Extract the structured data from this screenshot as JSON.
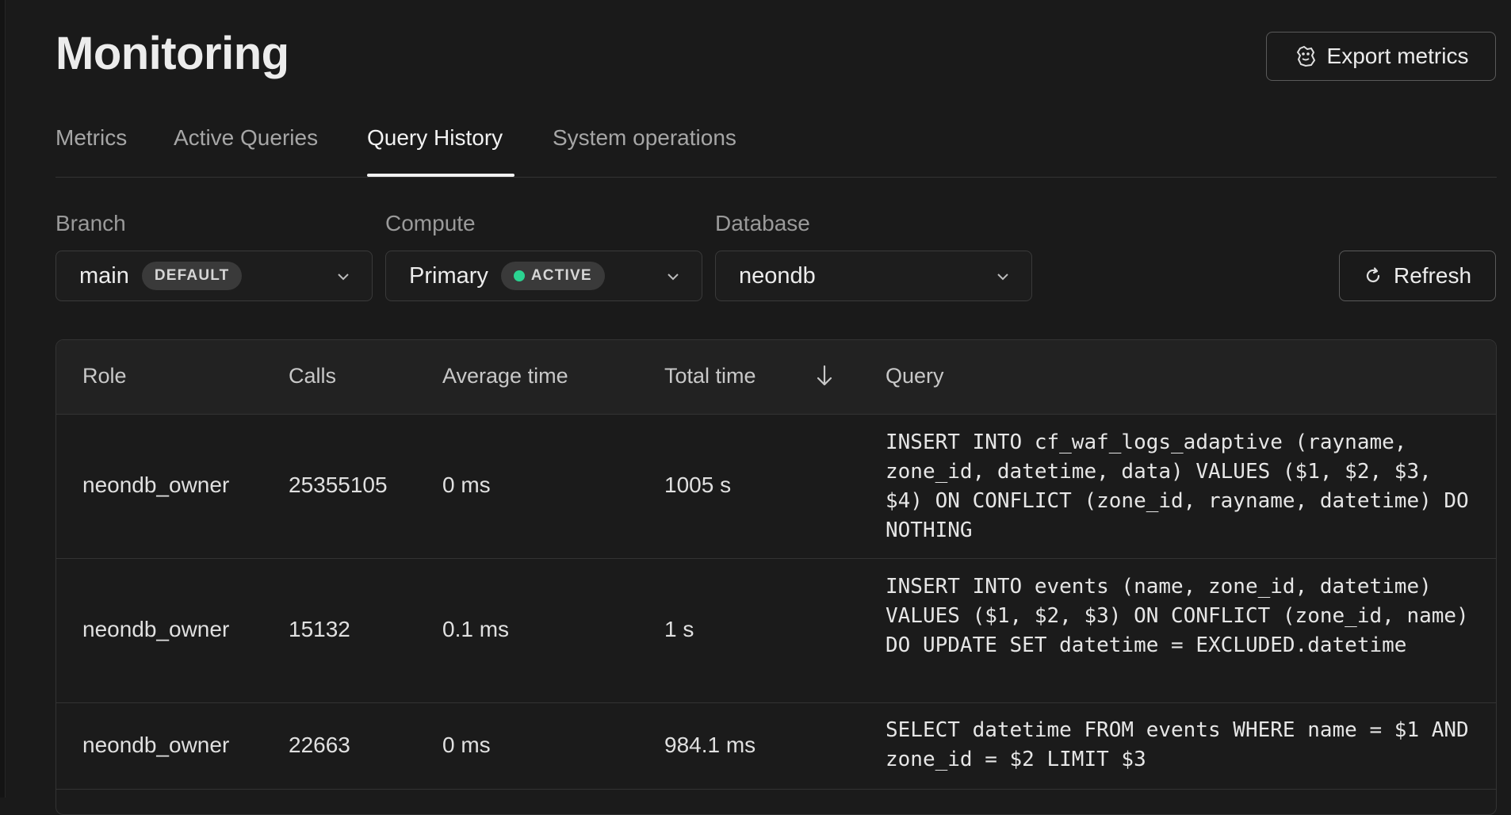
{
  "page": {
    "title": "Monitoring"
  },
  "export": {
    "label": "Export metrics",
    "icon": "datadog-icon"
  },
  "tabs": [
    {
      "label": "Metrics",
      "active": false
    },
    {
      "label": "Active Queries",
      "active": false
    },
    {
      "label": "Query History",
      "active": true
    },
    {
      "label": "System operations",
      "active": false
    }
  ],
  "filters": {
    "branch": {
      "label": "Branch",
      "value": "main",
      "badge": "DEFAULT"
    },
    "compute": {
      "label": "Compute",
      "value": "Primary",
      "badge": "ACTIVE",
      "badge_dot_color": "#2bd391"
    },
    "database": {
      "label": "Database",
      "value": "neondb"
    }
  },
  "refresh": {
    "label": "Refresh",
    "icon": "refresh-icon"
  },
  "table": {
    "columns": [
      "Role",
      "Calls",
      "Average time",
      "Total time",
      "Query"
    ],
    "sorted_by": "Total time",
    "sort_direction": "descending",
    "rows": [
      {
        "role": "neondb_owner",
        "calls": "25355105",
        "avg": "0 ms",
        "total": "1005 s",
        "query": "INSERT INTO cf_waf_logs_adaptive (rayname, zone_id, datetime, data) VALUES ($1, $2, $3, $4) ON CONFLICT (zone_id, rayname, datetime) DO NOTHING"
      },
      {
        "role": "neondb_owner",
        "calls": "15132",
        "avg": "0.1 ms",
        "total": "1 s",
        "query": "INSERT INTO events (name, zone_id, datetime) VALUES ($1, $2, $3) ON CONFLICT (zone_id, name) DO UPDATE SET datetime = EXCLUDED.datetime"
      },
      {
        "role": "neondb_owner",
        "calls": "22663",
        "avg": "0 ms",
        "total": "984.1 ms",
        "query": "SELECT datetime FROM events WHERE name = $1 AND zone_id = $2 LIMIT $3"
      }
    ]
  },
  "colors": {
    "background": "#1a1a1a",
    "accent_active": "#2bd391",
    "border": "#333333"
  }
}
